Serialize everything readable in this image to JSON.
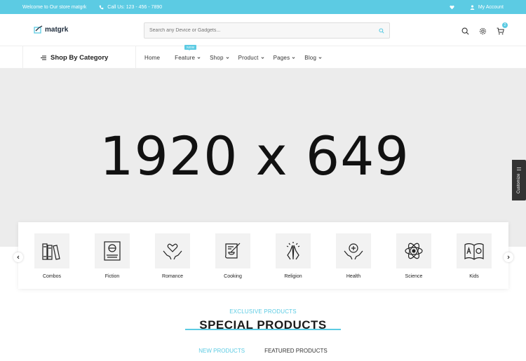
{
  "topbar": {
    "welcome": "Welcome to Our store matgrk",
    "call": "Call Us: 123 - 456 - 7890",
    "account": "My Account"
  },
  "header": {
    "logo": "matgrk",
    "search_placeholder": "Search any Device or Gadgets...",
    "cart_count": "2"
  },
  "nav": {
    "shop_by_category": "Shop By Category",
    "items": [
      {
        "label": "Home"
      },
      {
        "label": "Feature",
        "tag": "NEW"
      },
      {
        "label": "Shop"
      },
      {
        "label": "Product"
      },
      {
        "label": "Pages"
      },
      {
        "label": "Blog"
      }
    ]
  },
  "banner": {
    "text": "1920 x 649",
    "customize": "Customize"
  },
  "categories": [
    {
      "label": "Combos",
      "icon": "books-icon"
    },
    {
      "label": "Fiction",
      "icon": "fiction-book-icon"
    },
    {
      "label": "Romance",
      "icon": "heart-hands-icon"
    },
    {
      "label": "Cooking",
      "icon": "cooking-icon"
    },
    {
      "label": "Religion",
      "icon": "praying-hands-icon"
    },
    {
      "label": "Health",
      "icon": "health-hands-icon"
    },
    {
      "label": "Science",
      "icon": "atom-icon"
    },
    {
      "label": "Kids",
      "icon": "abc-book-icon"
    }
  ],
  "section": {
    "subtitle": "EXCLUSIVE PRODUCTS",
    "title": "SPECIAL PRODUCTS",
    "tabs": [
      "NEW PRODUCTS",
      "FEATURED PRODUCTS"
    ]
  },
  "colors": {
    "accent": "#5ccbe3",
    "banner_bg": "#ececec"
  }
}
